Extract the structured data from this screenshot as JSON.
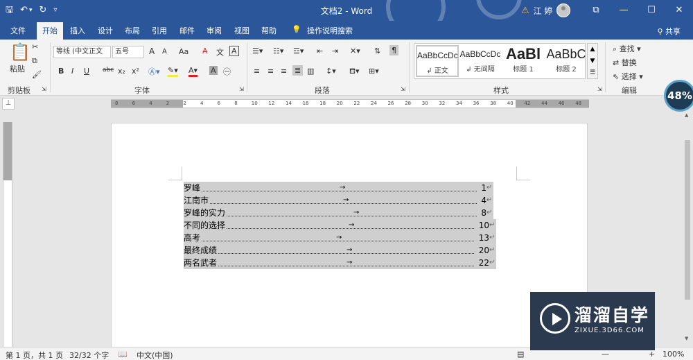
{
  "titlebar": {
    "doc_title": "文档2  -  Word",
    "user_name": "江 婷",
    "qat": {
      "save": "🖫",
      "undo": "↶",
      "undo_dd": "▾",
      "redo": "↻",
      "customize": "▿"
    },
    "win": {
      "ribbon_display": "⧉",
      "minimize": "—",
      "restore": "☐",
      "close": "✕"
    }
  },
  "tabs": [
    "文件",
    "开始",
    "插入",
    "设计",
    "布局",
    "引用",
    "邮件",
    "审阅",
    "视图",
    "帮助"
  ],
  "tell_me": "操作说明搜索",
  "share": "共享",
  "ribbon": {
    "clipboard": {
      "paste": "粘贴",
      "label": "剪贴板"
    },
    "font": {
      "family": "等线 (中文正文",
      "size": "五号",
      "bold": "B",
      "italic": "I",
      "underline": "U",
      "strike": "abc",
      "sub": "x₂",
      "sup": "x²",
      "grow": "A",
      "shrink": "A",
      "case": "Aa",
      "label": "字体"
    },
    "paragraph": {
      "label": "段落"
    },
    "styles": {
      "items": [
        {
          "sample": "AaBbCcDc",
          "name": "↲ 正文"
        },
        {
          "sample": "AaBbCcDc",
          "name": "↲ 无间隔"
        },
        {
          "sample": "AaBl",
          "name": "标题 1"
        },
        {
          "sample": "AaBbC",
          "name": "标题 2"
        }
      ],
      "label": "样式"
    },
    "editing": {
      "find": "查找",
      "replace": "替换",
      "select": "选择",
      "label": "编辑"
    }
  },
  "ruler": {
    "h_numbers": [
      "8",
      "6",
      "4",
      "2",
      "2",
      "4",
      "6",
      "8",
      "10",
      "12",
      "14",
      "16",
      "18",
      "20",
      "22",
      "24",
      "26",
      "28",
      "30",
      "32",
      "34",
      "36",
      "38",
      "40",
      "42",
      "44",
      "46",
      "48"
    ]
  },
  "toc": [
    {
      "title": "罗峰",
      "page": "1"
    },
    {
      "title": "江南市",
      "page": "4"
    },
    {
      "title": "罗峰的实力",
      "page": "8"
    },
    {
      "title": "不同的选择",
      "page": "10"
    },
    {
      "title": "高考",
      "page": "13"
    },
    {
      "title": "最终成绩",
      "page": "20"
    },
    {
      "title": "两名武者",
      "page": "22"
    }
  ],
  "progress_badge": "48%",
  "status": {
    "pages": "第 1 页，共 1 页",
    "words": "32/32 个字",
    "language": "中文(中国)",
    "zoom": "100%"
  },
  "watermark": {
    "cn": "溜溜自学",
    "url": "ZIXUE.3D66.COM"
  }
}
